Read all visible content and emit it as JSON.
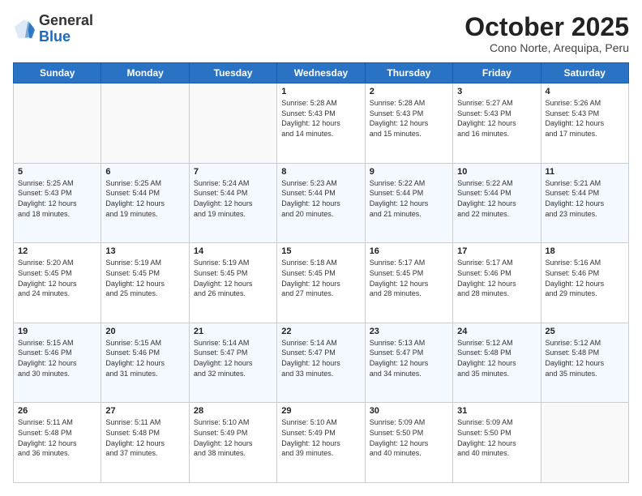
{
  "header": {
    "logo_general": "General",
    "logo_blue": "Blue",
    "month_title": "October 2025",
    "location": "Cono Norte, Arequipa, Peru"
  },
  "days_of_week": [
    "Sunday",
    "Monday",
    "Tuesday",
    "Wednesday",
    "Thursday",
    "Friday",
    "Saturday"
  ],
  "weeks": [
    {
      "days": [
        {
          "num": "",
          "info": ""
        },
        {
          "num": "",
          "info": ""
        },
        {
          "num": "",
          "info": ""
        },
        {
          "num": "1",
          "info": "Sunrise: 5:28 AM\nSunset: 5:43 PM\nDaylight: 12 hours\nand 14 minutes."
        },
        {
          "num": "2",
          "info": "Sunrise: 5:28 AM\nSunset: 5:43 PM\nDaylight: 12 hours\nand 15 minutes."
        },
        {
          "num": "3",
          "info": "Sunrise: 5:27 AM\nSunset: 5:43 PM\nDaylight: 12 hours\nand 16 minutes."
        },
        {
          "num": "4",
          "info": "Sunrise: 5:26 AM\nSunset: 5:43 PM\nDaylight: 12 hours\nand 17 minutes."
        }
      ]
    },
    {
      "days": [
        {
          "num": "5",
          "info": "Sunrise: 5:25 AM\nSunset: 5:43 PM\nDaylight: 12 hours\nand 18 minutes."
        },
        {
          "num": "6",
          "info": "Sunrise: 5:25 AM\nSunset: 5:44 PM\nDaylight: 12 hours\nand 19 minutes."
        },
        {
          "num": "7",
          "info": "Sunrise: 5:24 AM\nSunset: 5:44 PM\nDaylight: 12 hours\nand 19 minutes."
        },
        {
          "num": "8",
          "info": "Sunrise: 5:23 AM\nSunset: 5:44 PM\nDaylight: 12 hours\nand 20 minutes."
        },
        {
          "num": "9",
          "info": "Sunrise: 5:22 AM\nSunset: 5:44 PM\nDaylight: 12 hours\nand 21 minutes."
        },
        {
          "num": "10",
          "info": "Sunrise: 5:22 AM\nSunset: 5:44 PM\nDaylight: 12 hours\nand 22 minutes."
        },
        {
          "num": "11",
          "info": "Sunrise: 5:21 AM\nSunset: 5:44 PM\nDaylight: 12 hours\nand 23 minutes."
        }
      ]
    },
    {
      "days": [
        {
          "num": "12",
          "info": "Sunrise: 5:20 AM\nSunset: 5:45 PM\nDaylight: 12 hours\nand 24 minutes."
        },
        {
          "num": "13",
          "info": "Sunrise: 5:19 AM\nSunset: 5:45 PM\nDaylight: 12 hours\nand 25 minutes."
        },
        {
          "num": "14",
          "info": "Sunrise: 5:19 AM\nSunset: 5:45 PM\nDaylight: 12 hours\nand 26 minutes."
        },
        {
          "num": "15",
          "info": "Sunrise: 5:18 AM\nSunset: 5:45 PM\nDaylight: 12 hours\nand 27 minutes."
        },
        {
          "num": "16",
          "info": "Sunrise: 5:17 AM\nSunset: 5:45 PM\nDaylight: 12 hours\nand 28 minutes."
        },
        {
          "num": "17",
          "info": "Sunrise: 5:17 AM\nSunset: 5:46 PM\nDaylight: 12 hours\nand 28 minutes."
        },
        {
          "num": "18",
          "info": "Sunrise: 5:16 AM\nSunset: 5:46 PM\nDaylight: 12 hours\nand 29 minutes."
        }
      ]
    },
    {
      "days": [
        {
          "num": "19",
          "info": "Sunrise: 5:15 AM\nSunset: 5:46 PM\nDaylight: 12 hours\nand 30 minutes."
        },
        {
          "num": "20",
          "info": "Sunrise: 5:15 AM\nSunset: 5:46 PM\nDaylight: 12 hours\nand 31 minutes."
        },
        {
          "num": "21",
          "info": "Sunrise: 5:14 AM\nSunset: 5:47 PM\nDaylight: 12 hours\nand 32 minutes."
        },
        {
          "num": "22",
          "info": "Sunrise: 5:14 AM\nSunset: 5:47 PM\nDaylight: 12 hours\nand 33 minutes."
        },
        {
          "num": "23",
          "info": "Sunrise: 5:13 AM\nSunset: 5:47 PM\nDaylight: 12 hours\nand 34 minutes."
        },
        {
          "num": "24",
          "info": "Sunrise: 5:12 AM\nSunset: 5:48 PM\nDaylight: 12 hours\nand 35 minutes."
        },
        {
          "num": "25",
          "info": "Sunrise: 5:12 AM\nSunset: 5:48 PM\nDaylight: 12 hours\nand 35 minutes."
        }
      ]
    },
    {
      "days": [
        {
          "num": "26",
          "info": "Sunrise: 5:11 AM\nSunset: 5:48 PM\nDaylight: 12 hours\nand 36 minutes."
        },
        {
          "num": "27",
          "info": "Sunrise: 5:11 AM\nSunset: 5:48 PM\nDaylight: 12 hours\nand 37 minutes."
        },
        {
          "num": "28",
          "info": "Sunrise: 5:10 AM\nSunset: 5:49 PM\nDaylight: 12 hours\nand 38 minutes."
        },
        {
          "num": "29",
          "info": "Sunrise: 5:10 AM\nSunset: 5:49 PM\nDaylight: 12 hours\nand 39 minutes."
        },
        {
          "num": "30",
          "info": "Sunrise: 5:09 AM\nSunset: 5:50 PM\nDaylight: 12 hours\nand 40 minutes."
        },
        {
          "num": "31",
          "info": "Sunrise: 5:09 AM\nSunset: 5:50 PM\nDaylight: 12 hours\nand 40 minutes."
        },
        {
          "num": "",
          "info": ""
        }
      ]
    }
  ]
}
